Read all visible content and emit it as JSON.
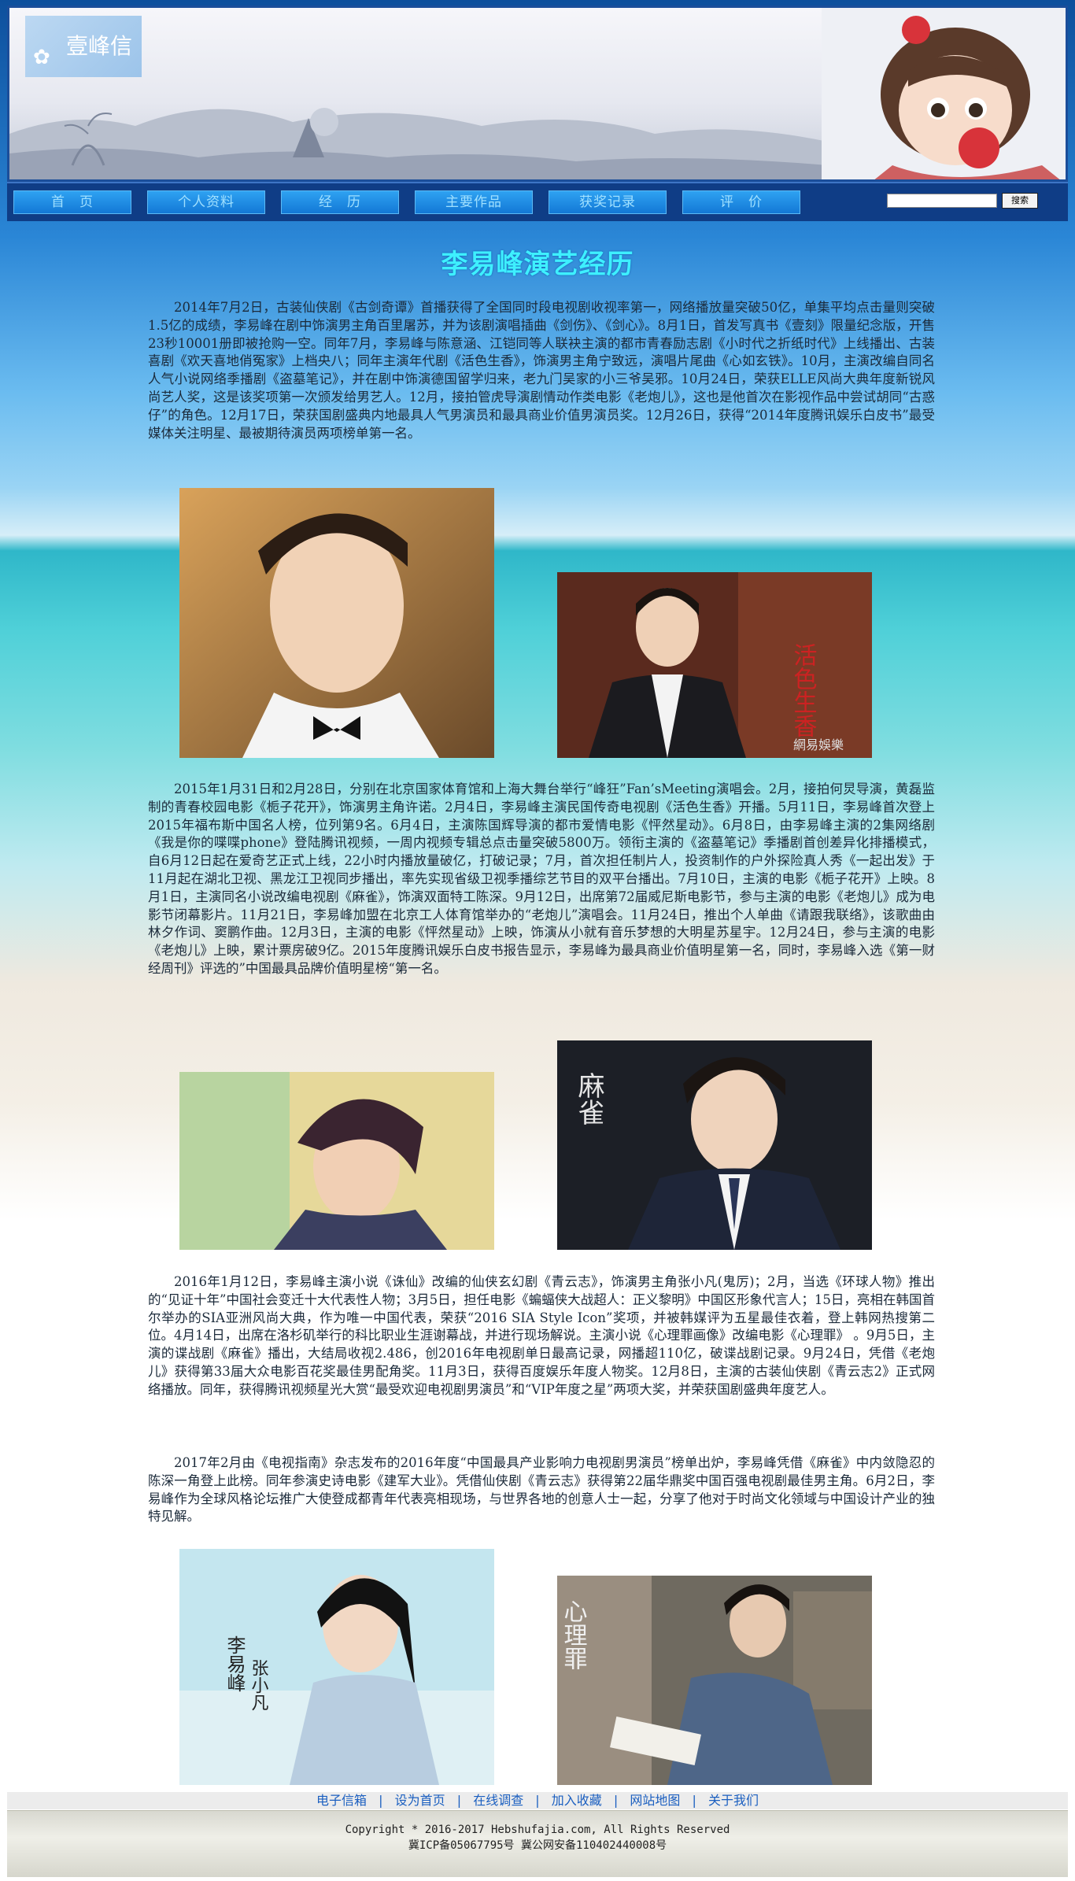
{
  "header": {
    "logo_text": "壹峰信",
    "logo_flower": "✿"
  },
  "nav": {
    "items": [
      "首　页",
      "个人资料",
      "经　历",
      "主要作品",
      "获奖记录",
      "评　价"
    ],
    "search_value": "",
    "search_button": "搜索"
  },
  "page_title": "李易峰演艺经历",
  "paragraphs": [
    "2014年7月2日，古装仙侠剧《古剑奇谭》首播获得了全国同时段电视剧收视率第一，网络播放量突破50亿，单集平均点击量则突破1.5亿的成绩，李易峰在剧中饰演男主角百里屠苏，并为该剧演唱插曲《剑伤》、《剑心》。8月1日，首发写真书《壹刻》限量纪念版，开售23秒10001册即被抢购一空。同年7月，李易峰与陈意涵、江铠同等人联袂主演的都市青春励志剧《小时代之折纸时代》上线播出、古装喜剧《欢天喜地俏冤家》上档央八；同年主演年代剧《活色生香》，饰演男主角宁致远，演唱片尾曲《心如玄铁》。10月，主演改编自同名人气小说网络季播剧《盗墓笔记》，并在剧中饰演德国留学归来，老九门吴家的小三爷吴邪。10月24日，荣获ELLE风尚大典年度新锐风尚艺人奖，这是该奖项第一次颁发给男艺人。12月，接拍管虎导演剧情动作类电影《老炮儿》，这也是他首次在影视作品中尝试胡同“古惑仔”的角色。12月17日，荣获国剧盛典内地最具人气男演员和最具商业价值男演员奖。12月26日，获得“2014年度腾讯娱乐白皮书”最受媒体关注明星、最被期待演员两项榜单第一名。",
    "2015年1月31日和2月28日，分别在北京国家体育馆和上海大舞台举行“峰狂”Fan’sMeeting演唱会。2月，接拍何炅导演，黄磊监制的青春校园电影《栀子花开》，饰演男主角许诺。2月4日，李易峰主演民国传奇电视剧《活色生香》开播。5月11日，李易峰首次登上2015年福布斯中国名人榜，位列第9名。6月4日，主演陈国辉导演的都市爱情电影《怦然星动》。6月8日，由李易峰主演的2集网络剧《我是你的喋喋phone》登陆腾讯视频，一周内视频专辑总点击量突破5800万。领衔主演的《盗墓笔记》季播剧首创差异化排播模式，自6月12日起在爱奇艺正式上线，22小时内播放量破亿，打破记录；7月，首次担任制片人，投资制作的户外探险真人秀《一起出发》于11月起在湖北卫视、黑龙江卫视同步播出，率先实现省级卫视季播综艺节目的双平台播出。7月10日，主演的电影《栀子花开》上映。8月1日，主演同名小说改编电视剧《麻雀》，饰演双面特工陈深。9月12日，出席第72届威尼斯电影节，参与主演的电影《老炮儿》成为电影节闭幕影片。11月21日，李易峰加盟在北京工人体育馆举办的“老炮儿”演唱会。11月24日，推出个人单曲《请跟我联络》，该歌曲由林夕作词、窦鹏作曲。12月3日，主演的电影《怦然星动》上映，饰演从小就有音乐梦想的大明星苏星宇。12月24日，参与主演的电影《老炮儿》上映，累计票房破9亿。2015年度腾讯娱乐白皮书报告显示，李易峰为最具商业价值明星第一名，同时，李易峰入选《第一财经周刊》评选的”中国最具品牌价值明星榜“第一名。",
    "2016年1月12日，李易峰主演小说《诛仙》改编的仙侠玄幻剧《青云志》，饰演男主角张小凡(鬼厉)；2月，当选《环球人物》推出的“见证十年”中国社会变迁十大代表性人物；3月5日，担任电影《蝙蝠侠大战超人：正义黎明》中国区形象代言人；15日，亮相在韩国首尔举办的SIA亚洲风尚大典，作为唯一中国代表，荣获“2016 SIA Style Icon”奖项，并被韩媒评为五星最佳衣着，登上韩网热搜第二位。4月14日，出席在洛杉矶举行的科比职业生涯谢幕战，并进行现场解说。主演小说《心理罪画像》改编电影《心理罪》 。9月5日，主演的谍战剧《麻雀》播出，大结局收视2.486，创2016年电视剧单日最高记录，网播超110亿，破谍战剧记录。9月24日，凭借《老炮儿》获得第33届大众电影百花奖最佳男配角奖。11月3日，获得百度娱乐年度人物奖。12月8日，主演的古装仙侠剧《青云志2》正式网络播放。同年，获得腾讯视频星光大赏“最受欢迎电视剧男演员”和“VIP年度之星”两项大奖，并荣获国剧盛典年度艺人。",
    "2017年2月由《电视指南》杂志发布的2016年度“中国最具产业影响力电视剧男演员”榜单出炉，李易峰凭借《麻雀》中内敛隐忍的陈深一角登上此榜。同年参演史诗电影《建军大业》。凭借仙侠剧《青云志》获得第22届华鼎奖中国百强电视剧最佳男主角。6月2日，李易峰作为全球风格论坛推广大使登成都青年代表亮相现场，与世界各地的创意人士一起，分享了他对于时尚文化领域与中国设计产业的独特见解。"
  ],
  "photo_captions": {
    "p2_watermark": "網易娛樂",
    "p2_title": "活色生香",
    "p4_title": "麻雀",
    "p5_name": "李易峰",
    "p5_role": "张小凡",
    "p6_title": "心理罪"
  },
  "footer": {
    "links": [
      "电子信箱",
      "设为首页",
      "在线调查",
      "加入收藏",
      "网站地图",
      "关于我们"
    ],
    "separator": "|",
    "copyright": "Copyright  *  2016-2017 Hebshufajia.com, All Rights Reserved",
    "icp": "冀ICP备05067795号 冀公网安备110402440008号"
  },
  "colors": {
    "title": "#3ef0ff",
    "nav_bg": "#0f3d86",
    "nav_button": "#1378d6",
    "link": "#1b5fc0"
  }
}
